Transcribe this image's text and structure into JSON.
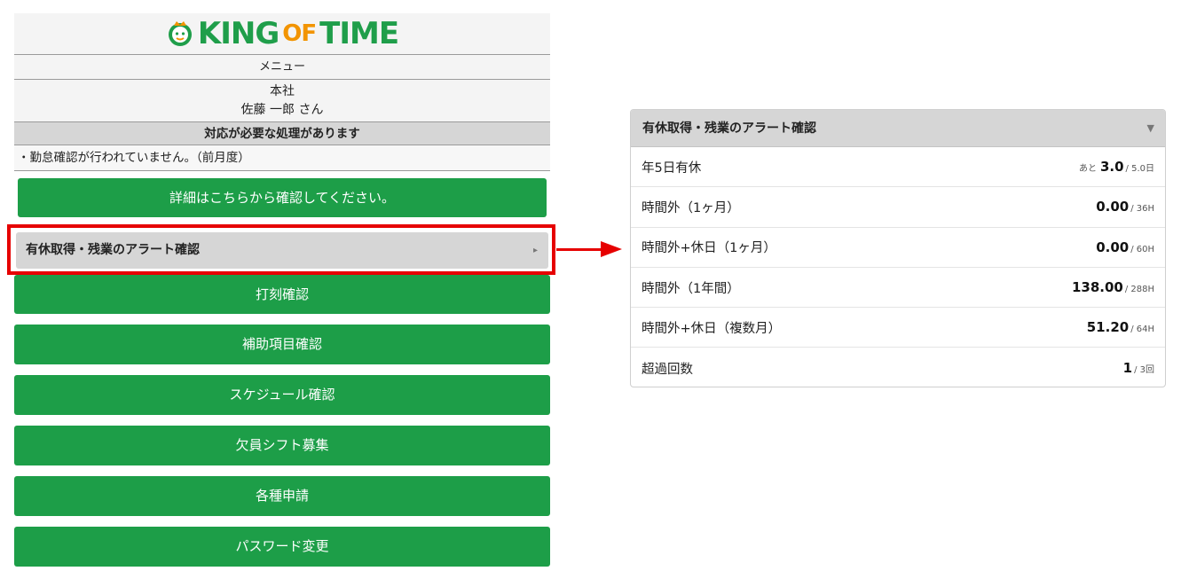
{
  "brand": {
    "logo_main": "KING",
    "logo_of": "OF",
    "logo_end": "TIME",
    "green": "#1d9e48",
    "orange": "#f29400"
  },
  "menu": {
    "label": "メニュー"
  },
  "user": {
    "company": "本社",
    "name": "佐藤 一郎 さん"
  },
  "alert": {
    "heading": "対応が必要な処理があります",
    "message": "・勤怠確認が行われていません。（前月度）",
    "detail_button": "詳細はこちらから確認してください。"
  },
  "alert_item": {
    "label": "有休取得・残業のアラート確認",
    "arrow": "▸"
  },
  "menu_buttons": [
    {
      "label": "打刻確認"
    },
    {
      "label": "補助項目確認"
    },
    {
      "label": "スケジュール確認"
    },
    {
      "label": "欠員シフト募集"
    },
    {
      "label": "各種申請"
    },
    {
      "label": "パスワード変更"
    }
  ],
  "highlight_color": "#e60000",
  "detail_panel": {
    "title": "有休取得・残業のアラート確認",
    "toggle": "▼",
    "rows": [
      {
        "label": "年5日有休",
        "prefix": "あと",
        "value": "3.0",
        "limit": "/ 5.0日"
      },
      {
        "label": "時間外（1ヶ月）",
        "prefix": "",
        "value": "0.00",
        "limit": "/ 36H"
      },
      {
        "label": "時間外+休日（1ヶ月）",
        "prefix": "",
        "value": "0.00",
        "limit": "/ 60H"
      },
      {
        "label": "時間外（1年間）",
        "prefix": "",
        "value": "138.00",
        "limit": "/ 288H"
      },
      {
        "label": "時間外+休日（複数月）",
        "prefix": "",
        "value": "51.20",
        "limit": "/ 64H"
      },
      {
        "label": "超過回数",
        "prefix": "",
        "value": "1",
        "limit": "/ 3回"
      }
    ]
  }
}
